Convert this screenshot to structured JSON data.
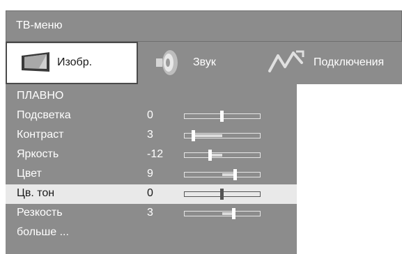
{
  "window": {
    "title": "ТВ-меню"
  },
  "tabs": [
    {
      "label": "Изобр.",
      "icon": "tv-screen-icon",
      "active": true
    },
    {
      "label": "Звук",
      "icon": "speaker-icon",
      "active": false
    },
    {
      "label": "Подключения",
      "icon": "connection-plug-icon",
      "active": false
    }
  ],
  "menu": {
    "items": [
      {
        "label": "ПЛАВНО",
        "value": ""
      },
      {
        "label": "Подсветка",
        "value": "0",
        "slider_fraction": 0.5
      },
      {
        "label": "Контраст",
        "value": "3",
        "slider_fraction": 0.12
      },
      {
        "label": "Яркость",
        "value": "-12",
        "slider_fraction": 0.34
      },
      {
        "label": "Цвет",
        "value": "9",
        "slider_fraction": 0.68
      },
      {
        "label": "Цв. тон",
        "value": "0",
        "slider_fraction": 0.5,
        "selected": true
      },
      {
        "label": "Резкость",
        "value": "3",
        "slider_fraction": 0.66
      },
      {
        "label": "больше ...",
        "value": ""
      }
    ]
  },
  "colors": {
    "panel": "#8c8c8c",
    "selected_row": "#e9e9e9",
    "text_light": "#ffffff",
    "text_dark": "#1a1a1a"
  }
}
